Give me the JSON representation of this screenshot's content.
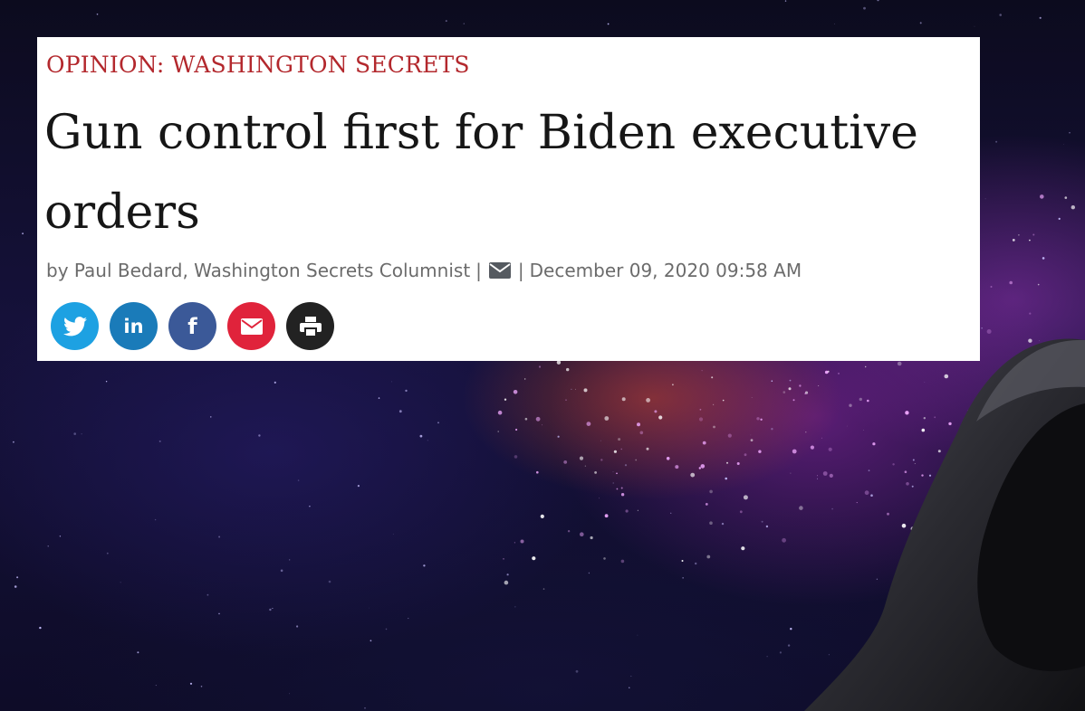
{
  "article": {
    "kicker": "OPINION: WASHINGTON SECRETS",
    "headline": "Gun control first for Biden executive orders",
    "byline": "by Paul Bedard, Washington Secrets Columnist",
    "date": "December 09, 2020 09:58 AM",
    "separator": "|"
  },
  "share_buttons": [
    {
      "name": "twitter-share-button",
      "icon": "twitter-icon",
      "color": "#1da1e2"
    },
    {
      "name": "linkedin-share-button",
      "icon": "linkedin-icon",
      "glyph": "in",
      "color": "#1a7bb9"
    },
    {
      "name": "facebook-share-button",
      "icon": "facebook-icon",
      "glyph": "f",
      "color": "#3b5998"
    },
    {
      "name": "email-share-button",
      "icon": "envelope-icon",
      "color": "#e0233b"
    },
    {
      "name": "print-button",
      "icon": "printer-icon",
      "color": "#222222"
    }
  ],
  "colors": {
    "kicker": "#b3282d",
    "headline": "#161616",
    "byline": "#6b6b6b"
  }
}
